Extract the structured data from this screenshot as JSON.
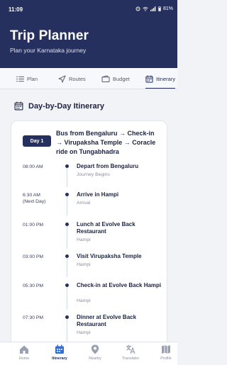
{
  "status_bar": {
    "time": "11:09",
    "battery": "81%"
  },
  "app": {
    "title": "Trip Planner",
    "subtitle": "Plan your Karnataka journey"
  },
  "tabs": [
    {
      "label": "Plan",
      "icon": "list-icon",
      "active": false
    },
    {
      "label": "Routes",
      "icon": "navigation-arrow-icon",
      "active": false
    },
    {
      "label": "Budget",
      "icon": "wallet-icon",
      "active": false
    },
    {
      "label": "Itinerary",
      "icon": "calendar-icon",
      "active": true
    }
  ],
  "section": {
    "title": "Day-by-Day Itinerary",
    "icon": "calendar-icon"
  },
  "day": {
    "badge": "Day 1",
    "route": "Bus from Bengaluru → Check-in → Virupaksha Temple → Coracle ride on Tungabhadra"
  },
  "events": [
    {
      "time": "08:00 AM",
      "time_note": "",
      "title": "Depart from Bengaluru",
      "subtitle": "Journey Begins"
    },
    {
      "time": "6:30 AM",
      "time_note": "(Next Day)",
      "title": "Arrive in Hampi",
      "subtitle": "Arrival"
    },
    {
      "time": "01:00 PM",
      "time_note": "",
      "title": "Lunch at Evolve Back Restaurant",
      "subtitle": "Hampi"
    },
    {
      "time": "03:00 PM",
      "time_note": "",
      "title": "Visit Virupaksha Temple",
      "subtitle": "Hampi"
    },
    {
      "time": "05:30 PM",
      "time_note": "",
      "title": "Check-in at Evolve Back Hampi",
      "subtitle": "Hampi"
    },
    {
      "time": "07:30 PM",
      "time_note": "",
      "title": "Dinner at Evolve Back Restaurant",
      "subtitle": "Hampi"
    }
  ],
  "bottom_nav": [
    {
      "label": "Home",
      "icon": "home-icon",
      "active": false
    },
    {
      "label": "Itinerary",
      "icon": "itinerary-icon",
      "active": true
    },
    {
      "label": "Nearby",
      "icon": "location-pin-icon",
      "active": false
    },
    {
      "label": "Translator",
      "icon": "translate-icon",
      "active": false
    },
    {
      "label": "Profile",
      "icon": "map-icon",
      "active": false
    }
  ],
  "colors": {
    "primary": "#26305e",
    "background": "#f2f3f7",
    "muted": "#8a8fa0"
  }
}
